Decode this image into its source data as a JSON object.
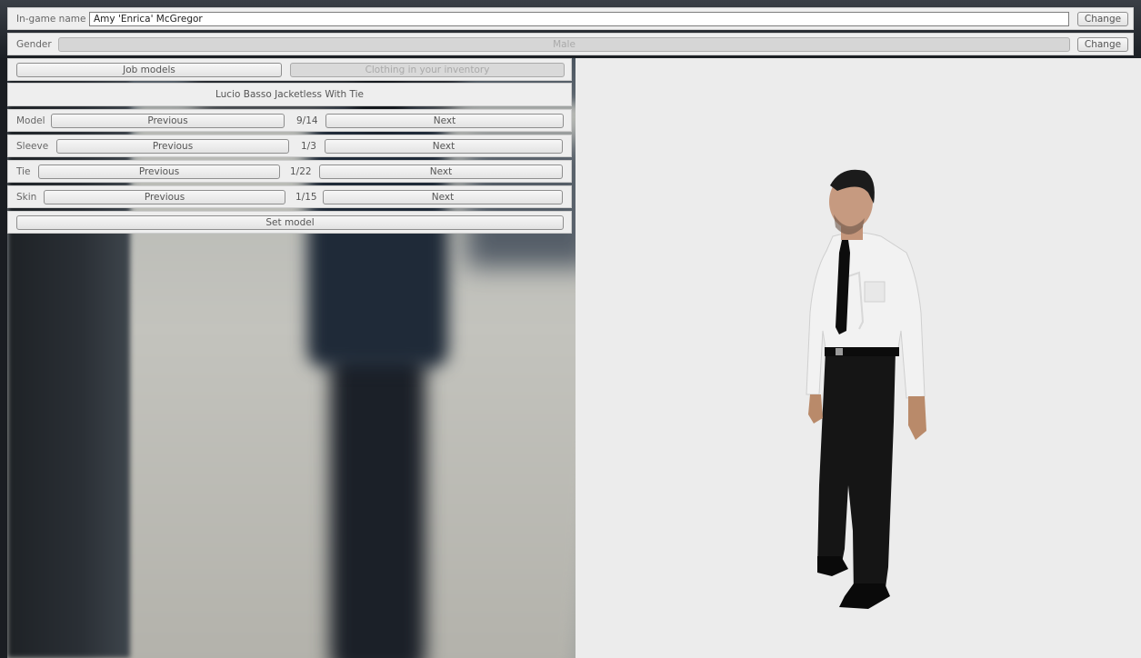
{
  "identity": {
    "name_label": "In-game name",
    "name_value": "Amy 'Enrica' McGregor",
    "name_change": "Change",
    "gender_label": "Gender",
    "gender_value": "Male",
    "gender_change": "Change"
  },
  "tabs": {
    "job_models": "Job models",
    "clothing_inventory": "Clothing in your inventory"
  },
  "outfit_name": "Lucio Basso Jacketless With Tie",
  "selectors": [
    {
      "label": "Model",
      "prev": "Previous",
      "count": "9/14",
      "next": "Next"
    },
    {
      "label": "Sleeve",
      "prev": "Previous",
      "count": "1/3",
      "next": "Next"
    },
    {
      "label": "Tie",
      "prev": "Previous",
      "count": "1/22",
      "next": "Next"
    },
    {
      "label": "Skin",
      "prev": "Previous",
      "count": "1/15",
      "next": "Next"
    }
  ],
  "set_model": "Set model"
}
